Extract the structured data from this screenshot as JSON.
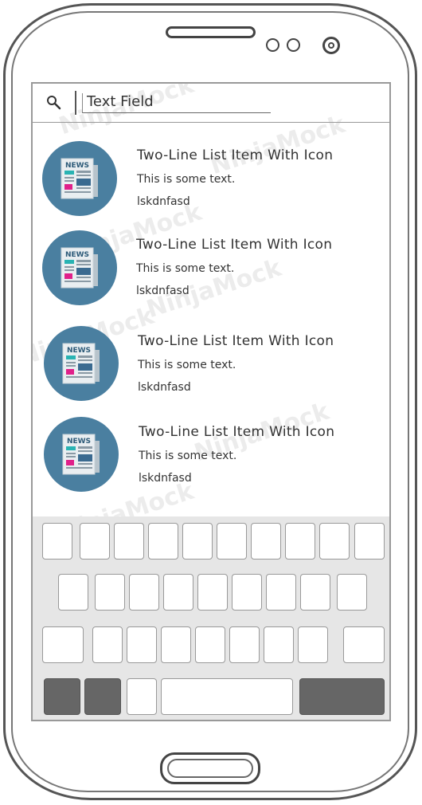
{
  "watermark": "NinjaMock",
  "search": {
    "value": "Text Field"
  },
  "list_items": [
    {
      "title": "Two-Line List Item With Icon",
      "line1": "This is some text.",
      "line2": "lskdnfasd",
      "icon_label": "NEWS"
    },
    {
      "title": "Two-Line List Item With Icon",
      "line1": "This is some text.",
      "line2": "lskdnfasd",
      "icon_label": "NEWS"
    },
    {
      "title": "Two-Line List Item With Icon",
      "line1": "This is some text.",
      "line2": "lskdnfasd",
      "icon_label": "NEWS"
    },
    {
      "title": "Two-Line List Item With Icon",
      "line1": "This is some text.",
      "line2": "lskdnfasd",
      "icon_label": "NEWS"
    }
  ],
  "colors": {
    "icon_circle": "#4a7fa0",
    "keyboard_bg": "#e6e6e6",
    "dark_key": "#666666"
  }
}
